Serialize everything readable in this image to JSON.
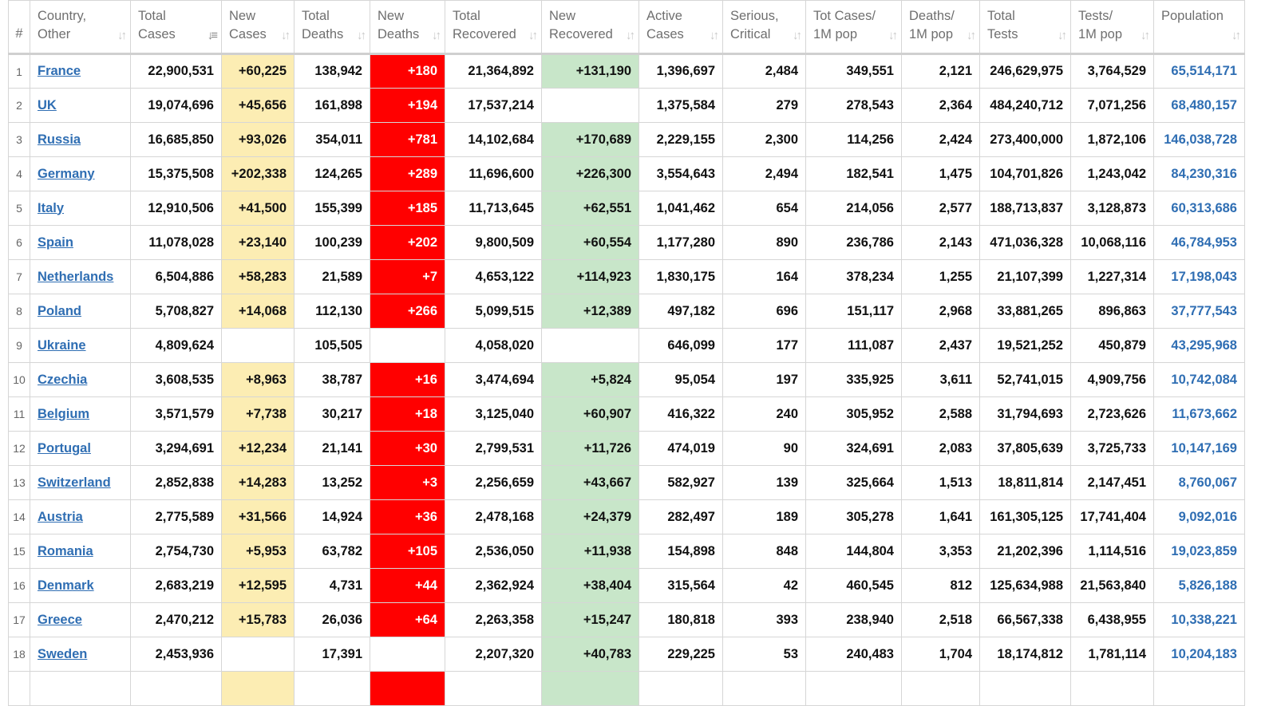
{
  "table": {
    "columns": [
      {
        "key": "num",
        "lines": [
          "#"
        ]
      },
      {
        "key": "country",
        "lines": [
          "Country,",
          "Other"
        ]
      },
      {
        "key": "total_cases",
        "lines": [
          "Total",
          "Cases"
        ]
      },
      {
        "key": "new_cases",
        "lines": [
          "New",
          "Cases"
        ]
      },
      {
        "key": "total_deaths",
        "lines": [
          "Total",
          "Deaths"
        ]
      },
      {
        "key": "new_deaths",
        "lines": [
          "New",
          "Deaths"
        ]
      },
      {
        "key": "total_recovered",
        "lines": [
          "Total",
          "Recovered"
        ]
      },
      {
        "key": "new_recovered",
        "lines": [
          "New",
          "Recovered"
        ]
      },
      {
        "key": "active_cases",
        "lines": [
          "Active",
          "Cases"
        ]
      },
      {
        "key": "serious_critical",
        "lines": [
          "Serious,",
          "Critical"
        ]
      },
      {
        "key": "tot_cases_1m",
        "lines": [
          "Tot Cases/",
          "1M pop"
        ]
      },
      {
        "key": "deaths_1m",
        "lines": [
          "Deaths/",
          "1M pop"
        ]
      },
      {
        "key": "total_tests",
        "lines": [
          "Total",
          "Tests"
        ]
      },
      {
        "key": "tests_1m",
        "lines": [
          "Tests/",
          "1M pop"
        ]
      },
      {
        "key": "population",
        "lines": [
          "Population"
        ]
      }
    ],
    "sorted_column": "total_cases",
    "colors": {
      "new_cases_bg": "#fcedb3",
      "new_deaths_bg": "#ff0000",
      "new_recovered_bg": "#c8e6c9",
      "link": "#2f6eb3"
    },
    "rows": [
      {
        "num": "1",
        "country": "France",
        "total_cases": "22,900,531",
        "new_cases": "+60,225",
        "total_deaths": "138,942",
        "new_deaths": "+180",
        "total_recovered": "21,364,892",
        "new_recovered": "+131,190",
        "active_cases": "1,396,697",
        "serious_critical": "2,484",
        "tot_cases_1m": "349,551",
        "deaths_1m": "2,121",
        "total_tests": "246,629,975",
        "tests_1m": "3,764,529",
        "population": "65,514,171"
      },
      {
        "num": "2",
        "country": "UK",
        "total_cases": "19,074,696",
        "new_cases": "+45,656",
        "total_deaths": "161,898",
        "new_deaths": "+194",
        "total_recovered": "17,537,214",
        "new_recovered": "",
        "active_cases": "1,375,584",
        "serious_critical": "279",
        "tot_cases_1m": "278,543",
        "deaths_1m": "2,364",
        "total_tests": "484,240,712",
        "tests_1m": "7,071,256",
        "population": "68,480,157"
      },
      {
        "num": "3",
        "country": "Russia",
        "total_cases": "16,685,850",
        "new_cases": "+93,026",
        "total_deaths": "354,011",
        "new_deaths": "+781",
        "total_recovered": "14,102,684",
        "new_recovered": "+170,689",
        "active_cases": "2,229,155",
        "serious_critical": "2,300",
        "tot_cases_1m": "114,256",
        "deaths_1m": "2,424",
        "total_tests": "273,400,000",
        "tests_1m": "1,872,106",
        "population": "146,038,728"
      },
      {
        "num": "4",
        "country": "Germany",
        "total_cases": "15,375,508",
        "new_cases": "+202,338",
        "total_deaths": "124,265",
        "new_deaths": "+289",
        "total_recovered": "11,696,600",
        "new_recovered": "+226,300",
        "active_cases": "3,554,643",
        "serious_critical": "2,494",
        "tot_cases_1m": "182,541",
        "deaths_1m": "1,475",
        "total_tests": "104,701,826",
        "tests_1m": "1,243,042",
        "population": "84,230,316"
      },
      {
        "num": "5",
        "country": "Italy",
        "total_cases": "12,910,506",
        "new_cases": "+41,500",
        "total_deaths": "155,399",
        "new_deaths": "+185",
        "total_recovered": "11,713,645",
        "new_recovered": "+62,551",
        "active_cases": "1,041,462",
        "serious_critical": "654",
        "tot_cases_1m": "214,056",
        "deaths_1m": "2,577",
        "total_tests": "188,713,837",
        "tests_1m": "3,128,873",
        "population": "60,313,686"
      },
      {
        "num": "6",
        "country": "Spain",
        "total_cases": "11,078,028",
        "new_cases": "+23,140",
        "total_deaths": "100,239",
        "new_deaths": "+202",
        "total_recovered": "9,800,509",
        "new_recovered": "+60,554",
        "active_cases": "1,177,280",
        "serious_critical": "890",
        "tot_cases_1m": "236,786",
        "deaths_1m": "2,143",
        "total_tests": "471,036,328",
        "tests_1m": "10,068,116",
        "population": "46,784,953"
      },
      {
        "num": "7",
        "country": "Netherlands",
        "total_cases": "6,504,886",
        "new_cases": "+58,283",
        "total_deaths": "21,589",
        "new_deaths": "+7",
        "total_recovered": "4,653,122",
        "new_recovered": "+114,923",
        "active_cases": "1,830,175",
        "serious_critical": "164",
        "tot_cases_1m": "378,234",
        "deaths_1m": "1,255",
        "total_tests": "21,107,399",
        "tests_1m": "1,227,314",
        "population": "17,198,043"
      },
      {
        "num": "8",
        "country": "Poland",
        "total_cases": "5,708,827",
        "new_cases": "+14,068",
        "total_deaths": "112,130",
        "new_deaths": "+266",
        "total_recovered": "5,099,515",
        "new_recovered": "+12,389",
        "active_cases": "497,182",
        "serious_critical": "696",
        "tot_cases_1m": "151,117",
        "deaths_1m": "2,968",
        "total_tests": "33,881,265",
        "tests_1m": "896,863",
        "population": "37,777,543"
      },
      {
        "num": "9",
        "country": "Ukraine",
        "total_cases": "4,809,624",
        "new_cases": "",
        "total_deaths": "105,505",
        "new_deaths": "",
        "total_recovered": "4,058,020",
        "new_recovered": "",
        "active_cases": "646,099",
        "serious_critical": "177",
        "tot_cases_1m": "111,087",
        "deaths_1m": "2,437",
        "total_tests": "19,521,252",
        "tests_1m": "450,879",
        "population": "43,295,968"
      },
      {
        "num": "10",
        "country": "Czechia",
        "total_cases": "3,608,535",
        "new_cases": "+8,963",
        "total_deaths": "38,787",
        "new_deaths": "+16",
        "total_recovered": "3,474,694",
        "new_recovered": "+5,824",
        "active_cases": "95,054",
        "serious_critical": "197",
        "tot_cases_1m": "335,925",
        "deaths_1m": "3,611",
        "total_tests": "52,741,015",
        "tests_1m": "4,909,756",
        "population": "10,742,084"
      },
      {
        "num": "11",
        "country": "Belgium",
        "total_cases": "3,571,579",
        "new_cases": "+7,738",
        "total_deaths": "30,217",
        "new_deaths": "+18",
        "total_recovered": "3,125,040",
        "new_recovered": "+60,907",
        "active_cases": "416,322",
        "serious_critical": "240",
        "tot_cases_1m": "305,952",
        "deaths_1m": "2,588",
        "total_tests": "31,794,693",
        "tests_1m": "2,723,626",
        "population": "11,673,662"
      },
      {
        "num": "12",
        "country": "Portugal",
        "total_cases": "3,294,691",
        "new_cases": "+12,234",
        "total_deaths": "21,141",
        "new_deaths": "+30",
        "total_recovered": "2,799,531",
        "new_recovered": "+11,726",
        "active_cases": "474,019",
        "serious_critical": "90",
        "tot_cases_1m": "324,691",
        "deaths_1m": "2,083",
        "total_tests": "37,805,639",
        "tests_1m": "3,725,733",
        "population": "10,147,169"
      },
      {
        "num": "13",
        "country": "Switzerland",
        "total_cases": "2,852,838",
        "new_cases": "+14,283",
        "total_deaths": "13,252",
        "new_deaths": "+3",
        "total_recovered": "2,256,659",
        "new_recovered": "+43,667",
        "active_cases": "582,927",
        "serious_critical": "139",
        "tot_cases_1m": "325,664",
        "deaths_1m": "1,513",
        "total_tests": "18,811,814",
        "tests_1m": "2,147,451",
        "population": "8,760,067"
      },
      {
        "num": "14",
        "country": "Austria",
        "total_cases": "2,775,589",
        "new_cases": "+31,566",
        "total_deaths": "14,924",
        "new_deaths": "+36",
        "total_recovered": "2,478,168",
        "new_recovered": "+24,379",
        "active_cases": "282,497",
        "serious_critical": "189",
        "tot_cases_1m": "305,278",
        "deaths_1m": "1,641",
        "total_tests": "161,305,125",
        "tests_1m": "17,741,404",
        "population": "9,092,016"
      },
      {
        "num": "15",
        "country": "Romania",
        "total_cases": "2,754,730",
        "new_cases": "+5,953",
        "total_deaths": "63,782",
        "new_deaths": "+105",
        "total_recovered": "2,536,050",
        "new_recovered": "+11,938",
        "active_cases": "154,898",
        "serious_critical": "848",
        "tot_cases_1m": "144,804",
        "deaths_1m": "3,353",
        "total_tests": "21,202,396",
        "tests_1m": "1,114,516",
        "population": "19,023,859"
      },
      {
        "num": "16",
        "country": "Denmark",
        "total_cases": "2,683,219",
        "new_cases": "+12,595",
        "total_deaths": "4,731",
        "new_deaths": "+44",
        "total_recovered": "2,362,924",
        "new_recovered": "+38,404",
        "active_cases": "315,564",
        "serious_critical": "42",
        "tot_cases_1m": "460,545",
        "deaths_1m": "812",
        "total_tests": "125,634,988",
        "tests_1m": "21,563,840",
        "population": "5,826,188"
      },
      {
        "num": "17",
        "country": "Greece",
        "total_cases": "2,470,212",
        "new_cases": "+15,783",
        "total_deaths": "26,036",
        "new_deaths": "+64",
        "total_recovered": "2,263,358",
        "new_recovered": "+15,247",
        "active_cases": "180,818",
        "serious_critical": "393",
        "tot_cases_1m": "238,940",
        "deaths_1m": "2,518",
        "total_tests": "66,567,338",
        "tests_1m": "6,438,955",
        "population": "10,338,221"
      },
      {
        "num": "18",
        "country": "Sweden",
        "total_cases": "2,453,936",
        "new_cases": "",
        "total_deaths": "17,391",
        "new_deaths": "",
        "total_recovered": "2,207,320",
        "new_recovered": "+40,783",
        "active_cases": "229,225",
        "serious_critical": "53",
        "tot_cases_1m": "240,483",
        "deaths_1m": "1,704",
        "total_tests": "18,174,812",
        "tests_1m": "1,781,114",
        "population": "10,204,183"
      },
      {
        "num": "",
        "country": "",
        "total_cases": "",
        "new_cases": "",
        "total_deaths": "",
        "new_deaths": "",
        "total_recovered": "",
        "new_recovered": "",
        "active_cases": "",
        "serious_critical": "",
        "tot_cases_1m": "",
        "deaths_1m": "",
        "total_tests": "",
        "tests_1m": "",
        "population": ""
      }
    ]
  }
}
